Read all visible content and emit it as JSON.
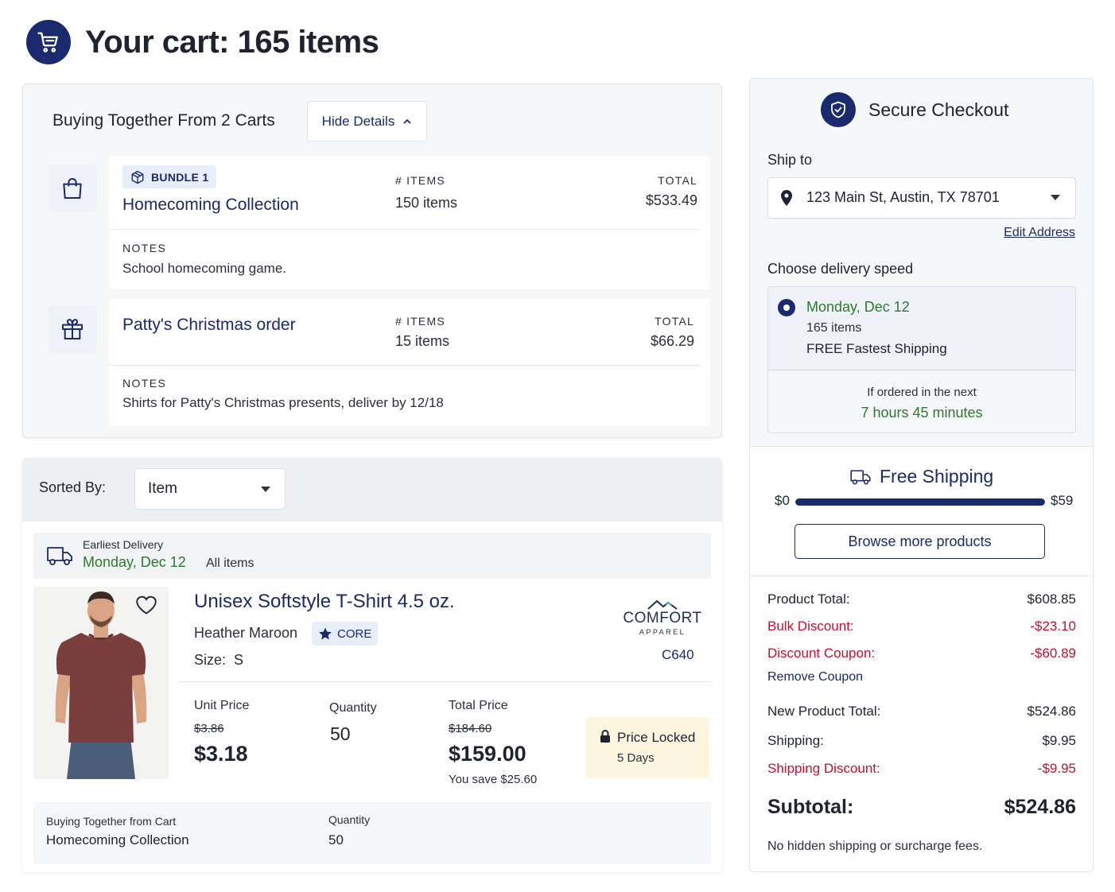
{
  "header": {
    "title": "Your cart: 165 items",
    "icon": "cart-icon"
  },
  "bundles_panel": {
    "title": "Buying Together From 2 Carts",
    "hide_details_label": "Hide Details",
    "items_label": "# ITEMS",
    "total_label": "TOTAL",
    "notes_label": "NOTES",
    "bundles": [
      {
        "tag": "BUNDLE 1",
        "name": "Homecoming Collection",
        "items": "150 items",
        "total": "$533.49",
        "notes": "School homecoming game.",
        "icon": "shopping-bag-icon"
      },
      {
        "tag": "",
        "name": "Patty's Christmas order",
        "items": "15 items",
        "total": "$66.29",
        "notes": "Shirts for Patty's Christmas presents, deliver by 12/18",
        "icon": "gift-icon"
      }
    ]
  },
  "sort_panel": {
    "sorted_by_label": "Sorted By:",
    "sort_value": "Item",
    "delivery": {
      "label": "Earliest Delivery",
      "date": "Monday, Dec 12",
      "scope": "All items"
    },
    "product": {
      "name": "Unisex Softstyle T-Shirt 4.5 oz.",
      "color": "Heather Maroon",
      "tag": "CORE",
      "size_label": "Size:",
      "size": "S",
      "brand_name": "COMFORT",
      "brand_sub": "APPAREL",
      "style_code": "C640",
      "unit_price_label": "Unit Price",
      "unit_price_old": "$3.86",
      "unit_price": "$3.18",
      "quantity_label": "Quantity",
      "quantity": "50",
      "total_price_label": "Total Price",
      "total_price_old": "$184.60",
      "total_price": "$159.00",
      "you_save": "You save $25.60",
      "lock_title": "Price Locked",
      "lock_duration": "5 Days",
      "shirt_color": "#7a3f3d"
    },
    "together": {
      "label": "Buying Together from Cart",
      "cart": "Homecoming Collection",
      "quantity_label": "Quantity",
      "quantity": "50"
    }
  },
  "checkout": {
    "title": "Secure Checkout",
    "ship_to_label": "Ship to",
    "address": "123 Main St, Austin, TX 78701",
    "edit_address": "Edit Address",
    "choose_speed_label": "Choose delivery speed",
    "speed": {
      "date": "Monday, Dec 12",
      "items": "165 items",
      "type": "FREE Fastest Shipping"
    },
    "ordered_next": "If ordered in the next",
    "countdown": "7 hours 45 minutes",
    "free_shipping": {
      "title": "Free Shipping",
      "min": "$0",
      "max": "$59",
      "progress": 1.0,
      "browse_label": "Browse more products"
    },
    "totals": {
      "product_total_label": "Product Total:",
      "product_total": "$608.85",
      "bulk_discount_label": "Bulk Discount:",
      "bulk_discount": "-$23.10",
      "coupon_label": "Discount Coupon:",
      "coupon": "-$60.89",
      "remove_coupon": "Remove Coupon",
      "new_total_label": "New Product Total:",
      "new_total": "$524.86",
      "shipping_label": "Shipping:",
      "shipping": "$9.95",
      "shipping_discount_label": "Shipping Discount:",
      "shipping_discount": "-$9.95",
      "subtotal_label": "Subtotal:",
      "subtotal": "$524.86",
      "note": "No hidden shipping or surcharge fees."
    }
  },
  "colors": {
    "navy": "#1a2a6c",
    "green": "#2d7a2d",
    "red": "#c8102e",
    "lock_bg": "#fdf5dd"
  }
}
